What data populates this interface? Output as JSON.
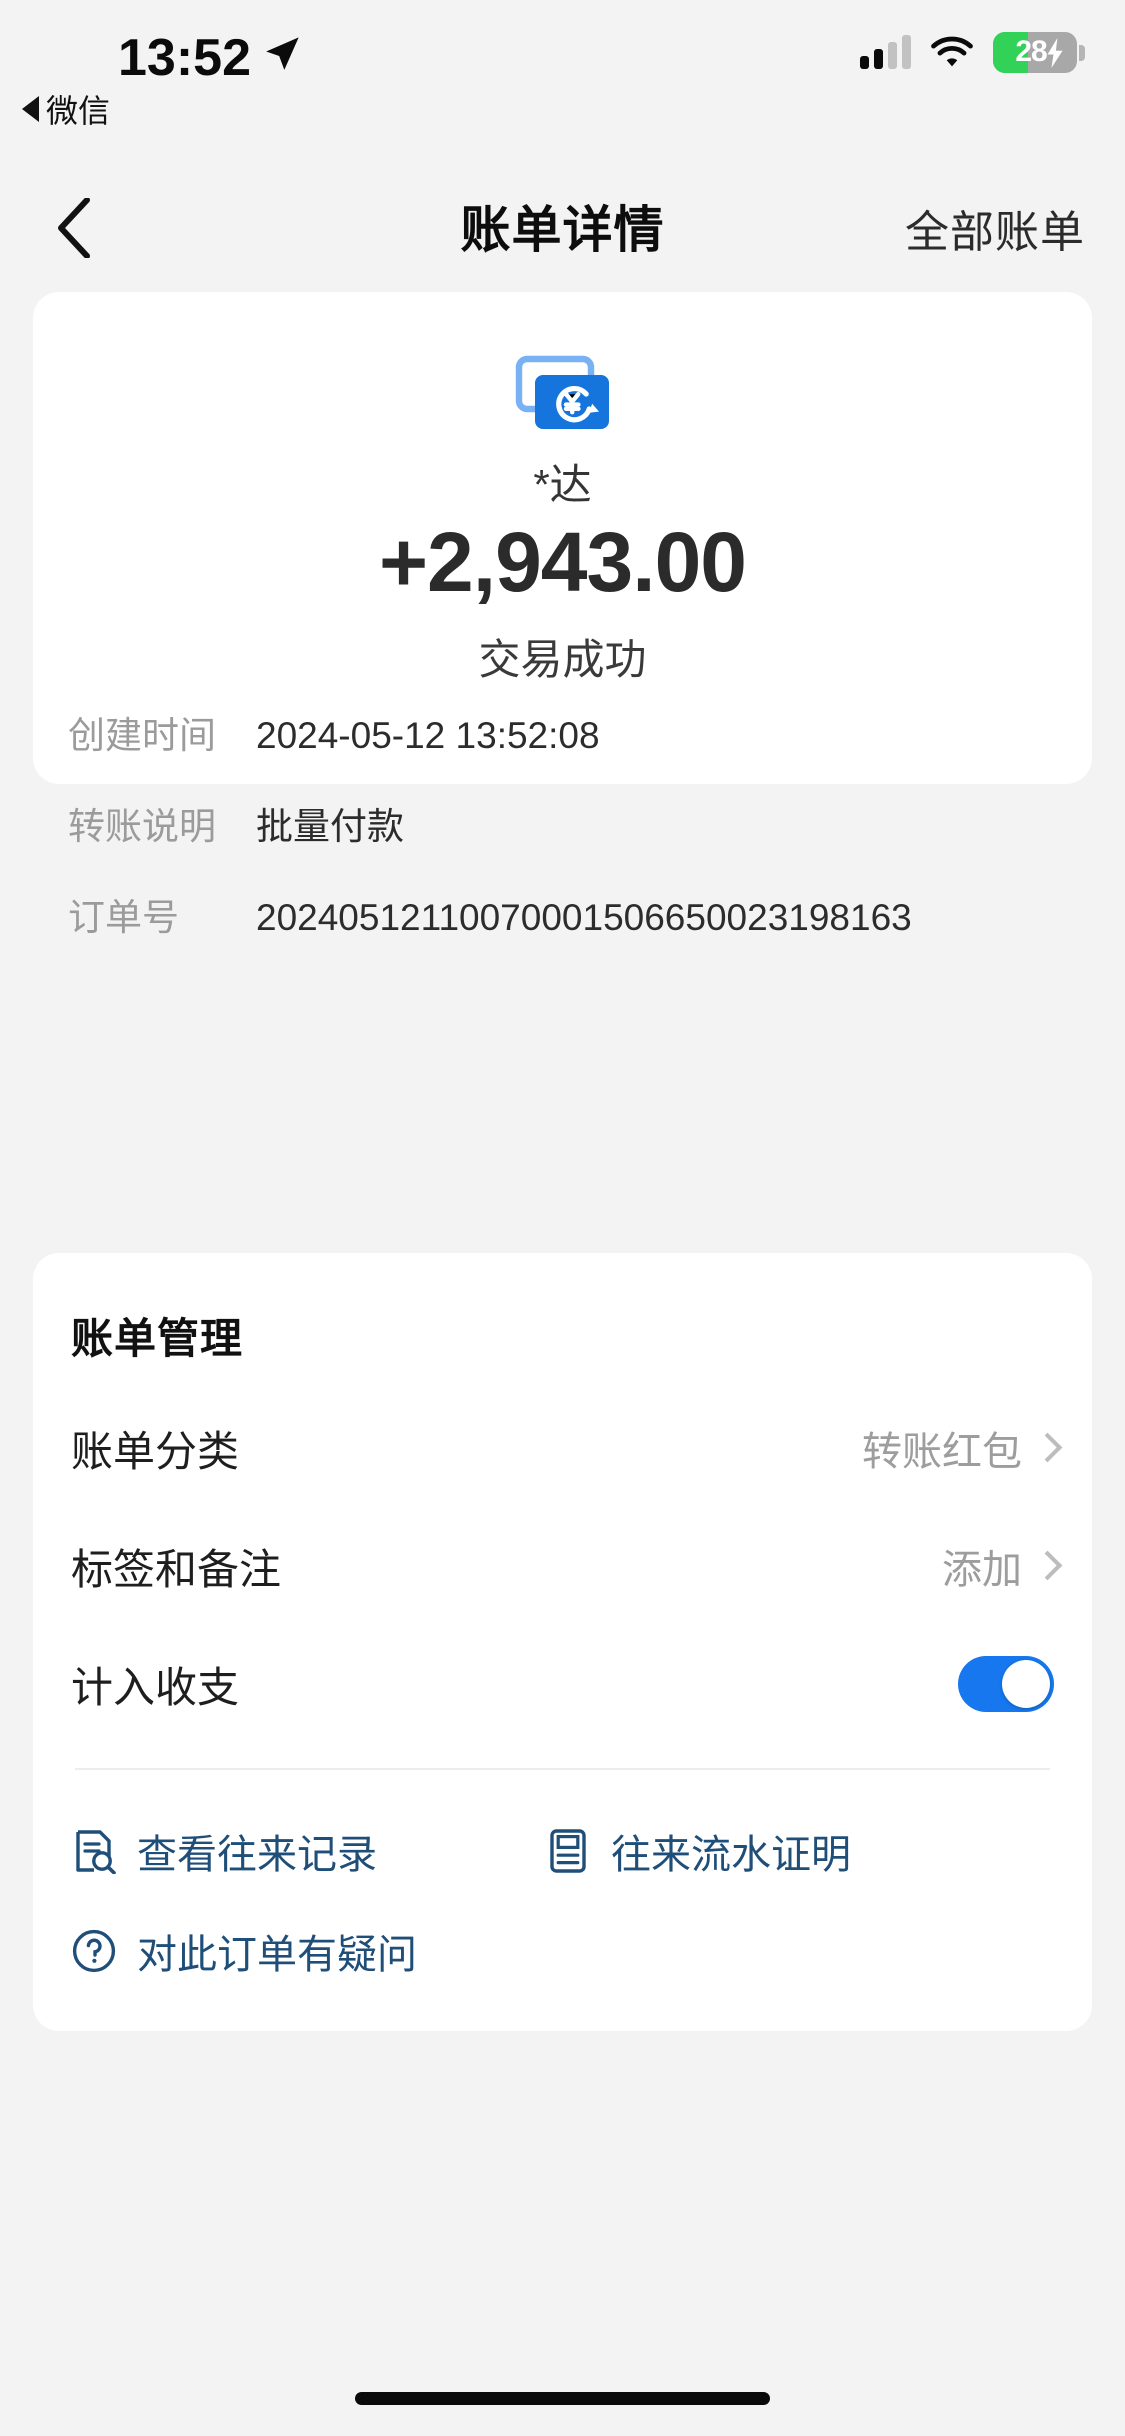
{
  "statusbar": {
    "time": "13:52",
    "location_icon": "location-arrow-icon",
    "return_app": "微信",
    "signal_icon": "cellular-signal-icon",
    "wifi_icon": "wifi-icon",
    "battery_level": "28",
    "battery_charging_icon": "charging-bolt-icon"
  },
  "navbar": {
    "back_icon": "chevron-left-icon",
    "title": "账单详情",
    "action_label": "全部账单"
  },
  "detail": {
    "icon": "transfer-card-stack-icon",
    "peer_name": "*达",
    "amount": "+2,943.00",
    "status": "交易成功",
    "rows": [
      {
        "label": "创建时间",
        "value": "2024-05-12 13:52:08"
      },
      {
        "label": "转账说明",
        "value": "批量付款"
      },
      {
        "label": "订单号",
        "value": "20240512110070001506650023198163"
      }
    ]
  },
  "manage": {
    "title": "账单管理",
    "rows": [
      {
        "label": "账单分类",
        "value": "转账红包",
        "accessory": "chevron-right-icon"
      },
      {
        "label": "标签和备注",
        "value": "添加",
        "accessory": "chevron-right-icon"
      },
      {
        "label": "计入收支",
        "value": "",
        "accessory": "toggle-on"
      }
    ],
    "links": [
      {
        "label": "查看往来记录",
        "icon": "document-search-icon"
      },
      {
        "label": "往来流水证明",
        "icon": "document-certificate-icon"
      },
      {
        "label": "对此订单有疑问",
        "icon": "question-circle-icon"
      }
    ]
  },
  "colors": {
    "accent_blue": "#1677ee",
    "link_blue": "#1f4e79",
    "battery_green": "#32d157",
    "page_bg": "#f3f3f3"
  },
  "home_indicator": "home-indicator-bar"
}
